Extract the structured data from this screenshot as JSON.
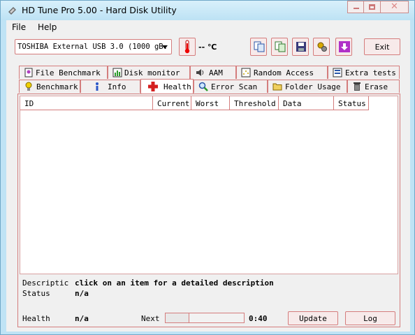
{
  "window": {
    "title": "HD Tune Pro 5.00 - Hard Disk Utility"
  },
  "menu": {
    "file": "File",
    "help": "Help"
  },
  "toolbar": {
    "drive_selected": "TOSHIBA External USB 3.0 (1000 gB.",
    "temperature": "-- ℃",
    "exit_label": "Exit",
    "icons": [
      "thermometer-icon",
      "copy-icon",
      "copy-all-icon",
      "save-icon",
      "options-icon",
      "download-icon"
    ]
  },
  "tabs_row1": [
    {
      "label": "File Benchmark",
      "icon": "file-benchmark-icon"
    },
    {
      "label": "Disk monitor",
      "icon": "disk-monitor-icon"
    },
    {
      "label": "AAM",
      "icon": "speaker-icon"
    },
    {
      "label": "Random Access",
      "icon": "random-access-icon"
    },
    {
      "label": "Extra tests",
      "icon": "extra-tests-icon"
    }
  ],
  "tabs_row2": [
    {
      "label": "Benchmark",
      "icon": "bulb-icon"
    },
    {
      "label": "Info",
      "icon": "info-icon"
    },
    {
      "label": "Health",
      "icon": "health-cross-icon"
    },
    {
      "label": "Error Scan",
      "icon": "magnifier-icon"
    },
    {
      "label": "Folder Usage",
      "icon": "folder-icon"
    },
    {
      "label": "Erase",
      "icon": "trash-icon"
    }
  ],
  "active_tab": "Health",
  "health_table": {
    "columns": [
      "ID",
      "Current",
      "Worst",
      "Threshold",
      "Data",
      "Status"
    ],
    "rows": []
  },
  "details": {
    "description_label": "Descriptic",
    "description_value": "click on an item for a detailed description",
    "status_label": "Status",
    "status_value": "n/a",
    "health_label": "Health",
    "health_value": "n/a",
    "next_label": "Next",
    "countdown": "0:40",
    "update_label": "Update",
    "log_label": "Log",
    "next_progress_fraction": 0.3
  },
  "colors": {
    "frame": "#bfe3f5",
    "accent_border": "#d47d7d"
  }
}
